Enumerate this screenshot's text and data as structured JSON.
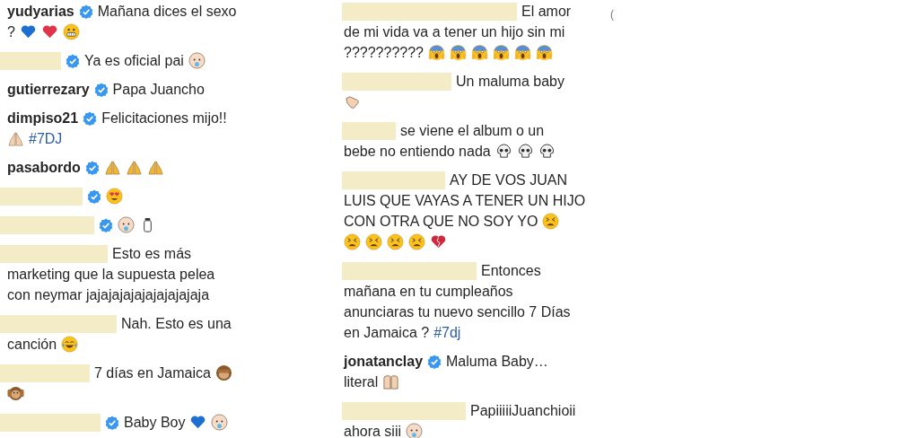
{
  "columns": [
    {
      "comments": [
        {
          "user": "yudyarias",
          "redacted": false,
          "verified": true,
          "lines": [
            [
              {
                "kind": "text",
                "text": "Mañana dices el sexo"
              }
            ],
            [
              {
                "kind": "text",
                "text": "?"
              },
              {
                "kind": "blue-heart"
              },
              {
                "kind": "red-heart"
              },
              {
                "kind": "grimacing"
              }
            ]
          ]
        },
        {
          "redacted": true,
          "verified": true,
          "lines": [
            [
              {
                "kind": "text",
                "text": "Ya es oficial pai"
              },
              {
                "kind": "baby"
              }
            ]
          ]
        },
        {
          "user": "gutierrezary",
          "redacted": false,
          "verified": true,
          "lines": [
            [
              {
                "kind": "text",
                "text": "Papa Juancho"
              }
            ]
          ]
        },
        {
          "user": "dimpiso21",
          "redacted": false,
          "verified": true,
          "lines": [
            [
              {
                "kind": "text",
                "text": "Felicitaciones mijo!!"
              }
            ],
            [
              {
                "kind": "praying-light"
              },
              {
                "kind": "hashtag",
                "text": "#7DJ"
              }
            ]
          ]
        },
        {
          "user": "pasabordo",
          "redacted": false,
          "verified": true,
          "lines": [
            [
              {
                "kind": "praying"
              },
              {
                "kind": "praying"
              },
              {
                "kind": "praying"
              }
            ]
          ]
        },
        {
          "redacted": true,
          "verified": true,
          "lines": [
            [
              {
                "kind": "heart-eyes"
              }
            ]
          ]
        },
        {
          "redacted": true,
          "verified": true,
          "lines": [
            [
              {
                "kind": "baby"
              },
              {
                "kind": "bottle"
              }
            ]
          ]
        },
        {
          "redacted": true,
          "verified": false,
          "lines": [
            [
              {
                "kind": "text",
                "text": "Esto es más"
              }
            ],
            [
              {
                "kind": "text",
                "text": "marketing que la supuesta pelea"
              }
            ],
            [
              {
                "kind": "text",
                "text": "con neymar jajajajajajajajajajaja"
              }
            ]
          ]
        },
        {
          "redacted": true,
          "verified": false,
          "lines": [
            [
              {
                "kind": "text",
                "text": "Nah. Esto es una"
              }
            ],
            [
              {
                "kind": "text",
                "text": "canción"
              },
              {
                "kind": "joy"
              }
            ]
          ]
        },
        {
          "redacted": true,
          "verified": false,
          "lines": [
            [
              {
                "kind": "text",
                "text": "7 días en Jamaica"
              },
              {
                "kind": "see-no-evil"
              }
            ],
            [
              {
                "kind": "hear-no-evil"
              }
            ]
          ]
        },
        {
          "redacted": true,
          "verified": true,
          "lines": [
            [
              {
                "kind": "text",
                "text": "Baby Boy"
              },
              {
                "kind": "blue-heart"
              },
              {
                "kind": "baby"
              }
            ]
          ]
        }
      ]
    },
    {
      "comments": [
        {
          "redacted": true,
          "verified": false,
          "lines": [
            [
              {
                "kind": "text",
                "text": "El amor"
              }
            ],
            [
              {
                "kind": "text",
                "text": "de mi vida va a tener un hijo sin mi"
              }
            ],
            [
              {
                "kind": "text",
                "text": "??????????"
              },
              {
                "kind": "scream"
              },
              {
                "kind": "scream"
              },
              {
                "kind": "scream"
              },
              {
                "kind": "scream"
              },
              {
                "kind": "scream"
              },
              {
                "kind": "scream"
              }
            ]
          ]
        },
        {
          "redacted": true,
          "verified": false,
          "lines": [
            [
              {
                "kind": "text",
                "text": "Un maluma baby"
              }
            ],
            [
              {
                "kind": "call-me"
              }
            ]
          ]
        },
        {
          "redacted": true,
          "verified": false,
          "lines": [
            [
              {
                "kind": "text",
                "text": "se viene el album o un"
              }
            ],
            [
              {
                "kind": "text",
                "text": "bebe no entiendo nada"
              },
              {
                "kind": "skull"
              },
              {
                "kind": "skull"
              },
              {
                "kind": "skull"
              }
            ]
          ]
        },
        {
          "redacted": true,
          "verified": false,
          "lines": [
            [
              {
                "kind": "text",
                "text": "AY DE VOS JUAN"
              }
            ],
            [
              {
                "kind": "text",
                "text": "LUIS QUE VAYAS A TENER UN HIJO"
              }
            ],
            [
              {
                "kind": "text",
                "text": "CON OTRA QUE NO SOY YO"
              },
              {
                "kind": "tired"
              }
            ],
            [
              {
                "kind": "tired"
              },
              {
                "kind": "tired"
              },
              {
                "kind": "tired"
              },
              {
                "kind": "tired"
              },
              {
                "kind": "broken-heart"
              }
            ]
          ]
        },
        {
          "redacted": true,
          "verified": false,
          "lines": [
            [
              {
                "kind": "text",
                "text": "Entonces"
              }
            ],
            [
              {
                "kind": "text",
                "text": "mañana en tu cumpleaños"
              }
            ],
            [
              {
                "kind": "text",
                "text": "anunciaras tu nuevo sencillo 7 Días"
              }
            ],
            [
              {
                "kind": "text",
                "text": "en Jamaica ?"
              },
              {
                "kind": "hashtag",
                "text": "#7dj"
              }
            ]
          ]
        },
        {
          "user": "jonatanclay",
          "redacted": false,
          "verified": true,
          "lines": [
            [
              {
                "kind": "text",
                "text": "Maluma Baby…"
              }
            ],
            [
              {
                "kind": "text",
                "text": "literal"
              },
              {
                "kind": "raising-hands"
              }
            ]
          ]
        },
        {
          "redacted": true,
          "verified": false,
          "lines": [
            [
              {
                "kind": "text",
                "text": "PapiiiiiJuanchioii"
              }
            ],
            [
              {
                "kind": "text",
                "text": "ahora siii"
              },
              {
                "kind": "baby"
              }
            ]
          ]
        }
      ]
    }
  ],
  "edge_fragment": "("
}
